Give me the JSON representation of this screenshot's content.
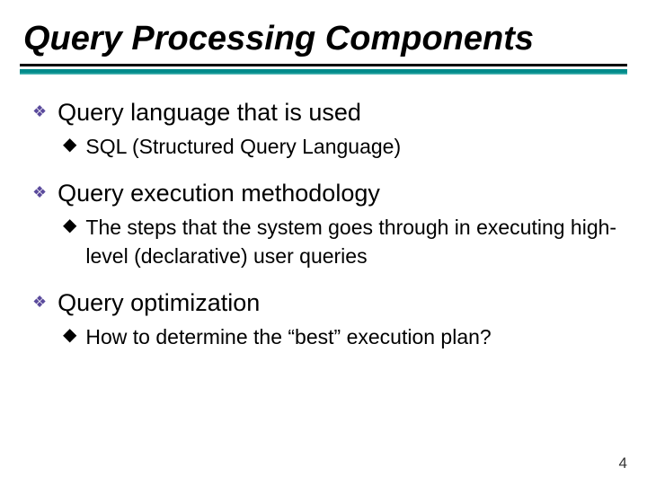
{
  "slide": {
    "title": "Query Processing Components",
    "page_number": "4",
    "bullets": [
      {
        "text": "Query language that is used",
        "sub": [
          "SQL (Structured Query Language)"
        ]
      },
      {
        "text": "Query execution methodology",
        "sub": [
          "The steps that the system goes through in executing high-level (declarative) user queries"
        ]
      },
      {
        "text": "Query optimization",
        "sub": [
          "How to determine the “best” execution plan?"
        ]
      }
    ]
  },
  "glyphs": {
    "diamond": "❖",
    "dot": "◆"
  }
}
